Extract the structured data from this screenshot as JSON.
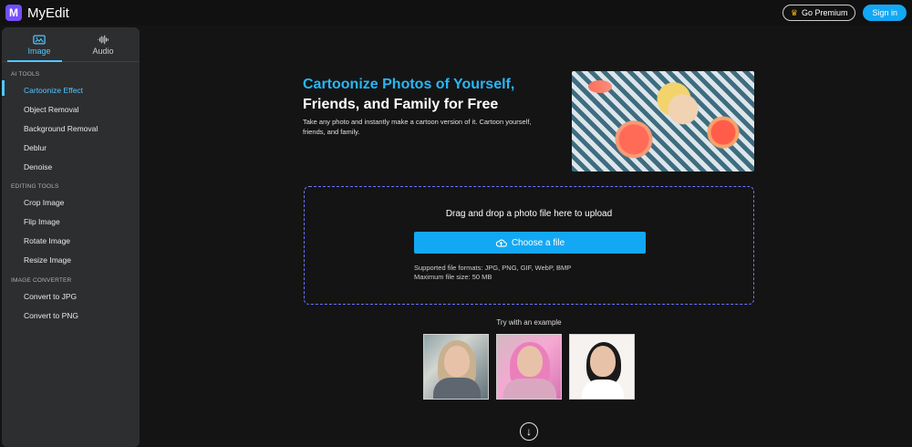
{
  "app": {
    "name": "MyEdit",
    "logo_letter": "M",
    "accent_color": "#13a8f3"
  },
  "header": {
    "premium_label": "Go Premium",
    "signin_label": "Sign in"
  },
  "sidebar": {
    "tabs": [
      {
        "label": "Image",
        "icon": "image-icon",
        "active": true
      },
      {
        "label": "Audio",
        "icon": "audio-waveform-icon",
        "active": false
      }
    ],
    "sections": [
      {
        "label": "AI TOOLS",
        "items": [
          "Cartoonize Effect",
          "Object Removal",
          "Background Removal",
          "Deblur",
          "Denoise"
        ]
      },
      {
        "label": "EDITING TOOLS",
        "items": [
          "Crop Image",
          "Flip Image",
          "Rotate Image",
          "Resize Image"
        ]
      },
      {
        "label": "IMAGE CONVERTER",
        "items": [
          "Convert to JPG",
          "Convert to PNG"
        ]
      }
    ]
  },
  "main": {
    "title_blue": "Cartoonize Photos of Yourself,",
    "title_white": "Friends, and Family for Free",
    "description": "Take any photo and instantly make a cartoon version of it. Cartoon yourself, friends, and family.",
    "upload": {
      "title": "Drag and drop a photo file here to upload",
      "button_label": "Choose a file",
      "formats": "Supported file formats: JPG, PNG, GIF, WebP, BMP",
      "max_size": "Maximum file size: 50 MB"
    },
    "examples_label": "Try with an example"
  }
}
